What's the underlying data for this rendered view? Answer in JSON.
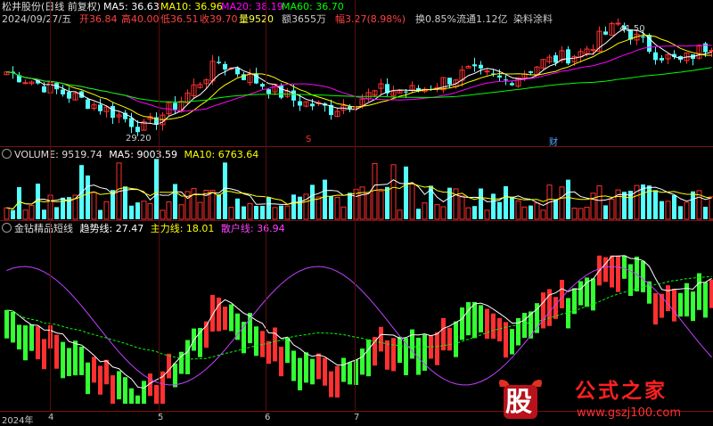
{
  "header": {
    "stock_title": "松井股份(日线 前复权)",
    "ma5_label": "MA5: 36.63",
    "ma10_label": "MA10: 36.96",
    "ma20_label": "MA20: 38.19",
    "ma60_label": "MA60: 36.70",
    "date": "2024/09/27/五",
    "open": "开36.84",
    "high": "高40.00",
    "low": "低36.51",
    "close": "收39.70",
    "volume": "量9520",
    "amount": "额3655万",
    "change": "幅3.27(8.98%)",
    "turnover": "换0.85%",
    "float": "流通1.12亿",
    "sector": "染料涂料"
  },
  "price_annotations": {
    "high_mark": "41.50",
    "low_mark": "29.20",
    "event_s": "S",
    "event_cai": "财"
  },
  "volume_header": {
    "volume": "VOLUME: 9519.74",
    "ma5": "MA5: 9003.59",
    "ma10": "MA10: 6763.64"
  },
  "indicator_header": {
    "name": "金钻精品短线",
    "trend": "趋势线: 27.47",
    "main": "主力线: 18.01",
    "retail": "散户线: 36.94"
  },
  "time_axis": [
    "2024年",
    "4",
    "5",
    "6",
    "7"
  ],
  "watermark": {
    "char": "股",
    "text": "公式之家",
    "url": "www.gszj100.com"
  },
  "colors": {
    "up": "#ff3030",
    "down": "#54ffff",
    "ma5": "#ffffff",
    "ma10": "#ffff00",
    "ma20": "#ff00ff",
    "ma60": "#00ff00",
    "retail_line": "#c040ff",
    "indicator_green": "#33ff33"
  }
}
